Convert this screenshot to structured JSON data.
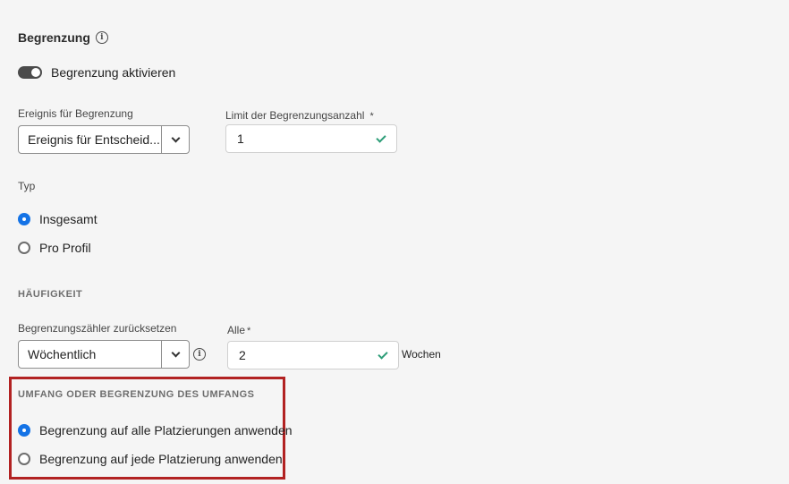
{
  "capping": {
    "title": "Begrenzung",
    "info_icon": "info-icon",
    "toggle_label": "Begrenzung aktivieren",
    "toggle_on": true
  },
  "event_field": {
    "label": "Ereignis für Begrenzung",
    "value": "Ereignis für Entscheid..."
  },
  "limit_field": {
    "label": "Limit der Begrenzungsanzahl",
    "required_mark": "*",
    "value": "1"
  },
  "type_group": {
    "label": "Typ",
    "options": [
      {
        "label": "Insgesamt",
        "checked": true
      },
      {
        "label": "Pro Profil",
        "checked": false
      }
    ]
  },
  "frequency": {
    "heading": "HÄUFIGKEIT",
    "reset_label": "Begrenzungszähler zurücksetzen",
    "reset_value": "Wöchentlich",
    "every_label": "Alle",
    "every_required_mark": "*",
    "every_value": "2",
    "every_unit": "Wochen"
  },
  "scope": {
    "heading": "UMFANG ODER BEGRENZUNG DES UMFANGS",
    "options": [
      {
        "label": "Begrenzung auf alle Platzierungen anwenden",
        "checked": true
      },
      {
        "label": "Begrenzung auf jede Platzierung anwenden",
        "checked": false
      }
    ]
  },
  "colors": {
    "accent": "#1473e6",
    "valid_check": "#2d9d78",
    "highlight_border": "#b22222"
  }
}
